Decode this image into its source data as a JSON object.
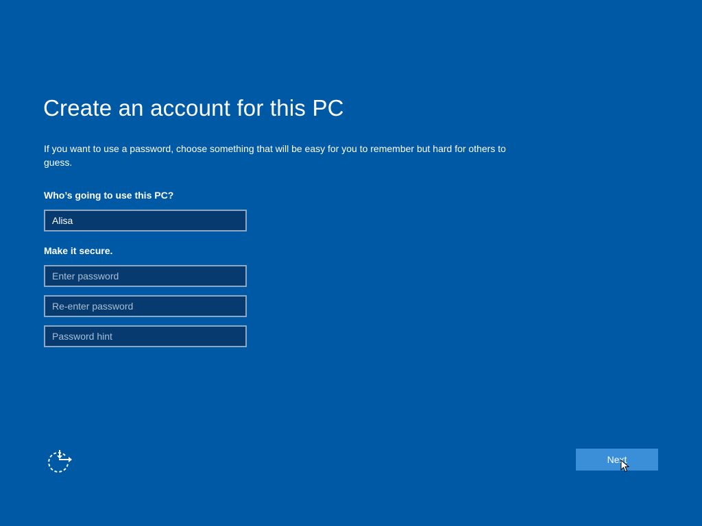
{
  "page": {
    "title": "Create an account for this PC",
    "description": "If you want to use a password, choose something that will be easy for you to remember but hard for others to guess."
  },
  "form": {
    "who_label": "Who’s going to use this PC?",
    "username_value": "Alisa",
    "secure_label": "Make it secure.",
    "password_placeholder": "Enter password",
    "reenter_placeholder": "Re-enter password",
    "hint_placeholder": "Password hint"
  },
  "footer": {
    "accessibility_icon": "ease-of-access-icon",
    "next_label": "Next"
  },
  "colors": {
    "background": "#0059a5",
    "field_background": "#073a6e",
    "field_border": "#8fa8c4",
    "button_background": "#3b8fd9"
  }
}
